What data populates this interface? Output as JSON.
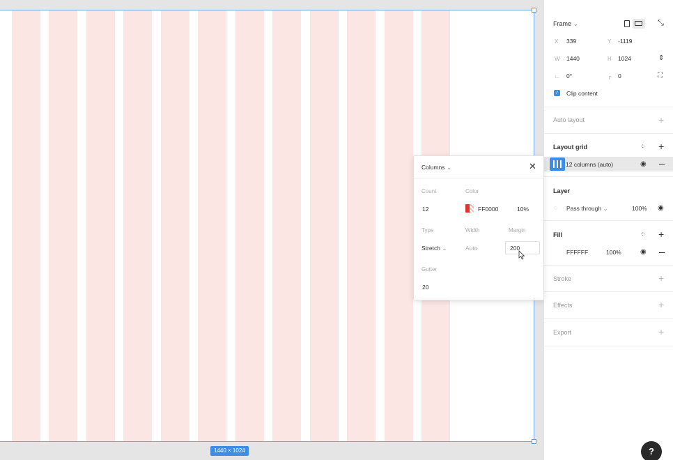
{
  "canvas": {
    "frame_size_label": "1440 × 1024",
    "grid_color": "#fbe6e4",
    "selection_color": "#3d8ce6"
  },
  "panel": {
    "frame": {
      "title": "Frame",
      "x_label": "X",
      "x_value": "339",
      "y_label": "Y",
      "y_value": "-1119",
      "w_label": "W",
      "w_value": "1440",
      "h_label": "H",
      "h_value": "1024",
      "rotation_value": "0°",
      "radius_value": "0",
      "clip_content_label": "Clip content",
      "clip_content_checked": true
    },
    "auto_layout": {
      "title": "Auto layout"
    },
    "layout_grid": {
      "title": "Layout grid",
      "item_label": "12 columns (auto)"
    },
    "layer": {
      "title": "Layer",
      "blend_mode": "Pass through",
      "opacity": "100%"
    },
    "fill": {
      "title": "Fill",
      "hex": "FFFFFF",
      "opacity": "100%"
    },
    "stroke": {
      "title": "Stroke"
    },
    "effects": {
      "title": "Effects"
    },
    "export": {
      "title": "Export"
    }
  },
  "popover": {
    "grid_type": "Columns",
    "count_label": "Count",
    "count_value": "12",
    "color_label": "Color",
    "color_hex": "FF0000",
    "color_opacity": "10%",
    "type_label": "Type",
    "type_value": "Stretch",
    "width_label": "Width",
    "width_value": "Auto",
    "margin_label": "Margin",
    "margin_value": "200",
    "gutter_label": "Gutter",
    "gutter_value": "20"
  },
  "help": {
    "label": "?"
  }
}
